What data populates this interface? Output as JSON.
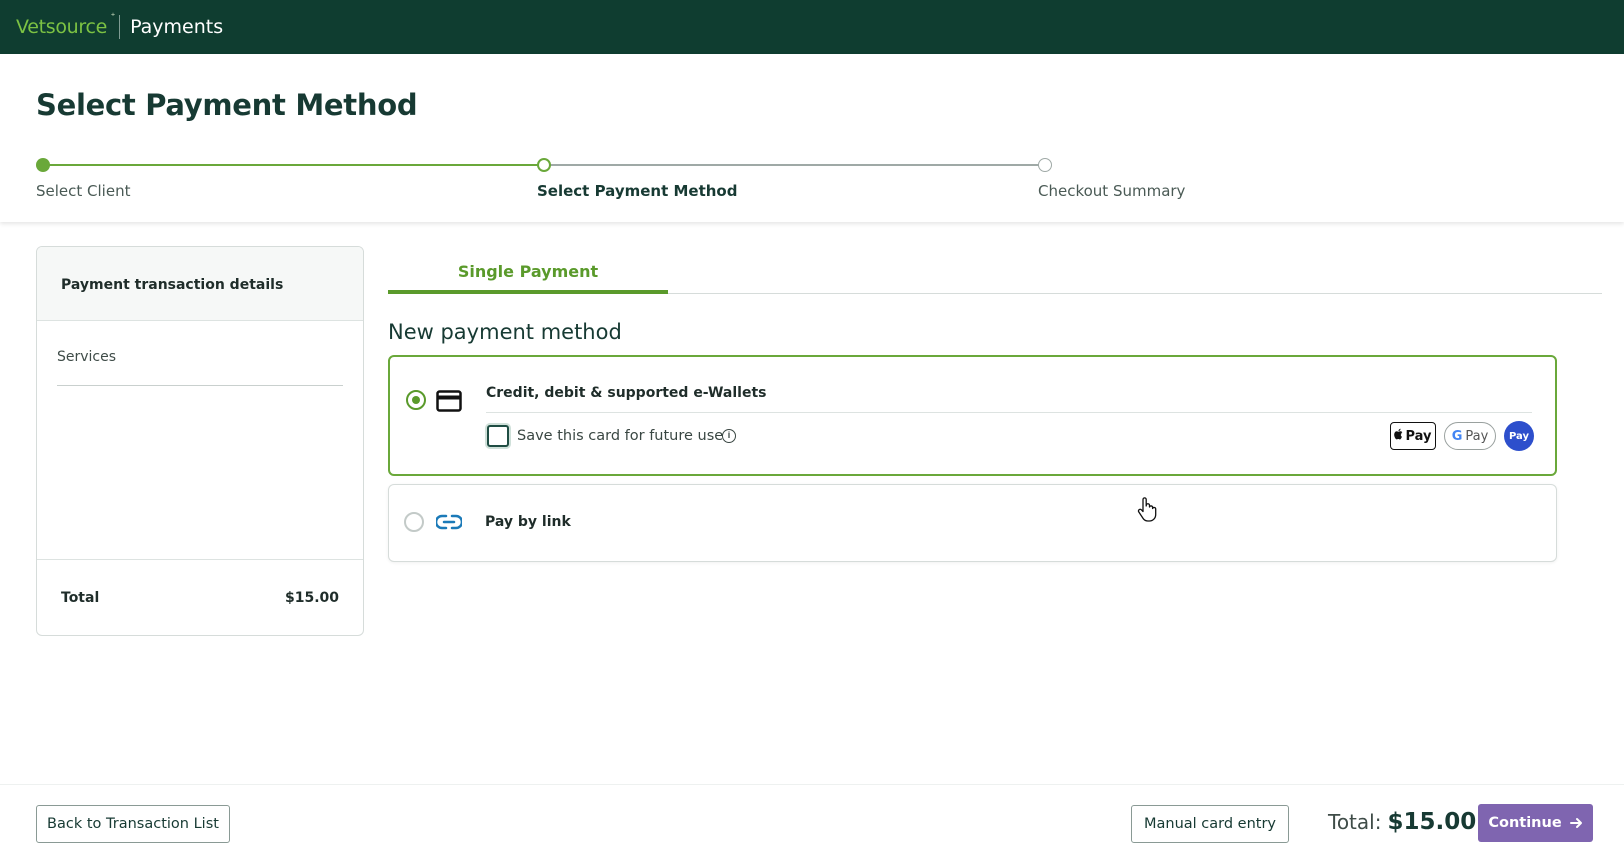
{
  "topbar": {
    "brand": "Vetsource",
    "app_name": "Payments"
  },
  "page": {
    "title": "Select Payment Method"
  },
  "stepper": {
    "steps": [
      {
        "label": "Select Client"
      },
      {
        "label": "Select Payment Method"
      },
      {
        "label": "Checkout Summary"
      }
    ]
  },
  "summary": {
    "header": "Payment transaction details",
    "services_label": "Services",
    "total_label": "Total",
    "total_value": "$15.00"
  },
  "tabs": [
    {
      "label": "Single Payment"
    }
  ],
  "payment": {
    "section_title": "New payment method",
    "card_option": {
      "label": "Credit, debit & supported e-Wallets",
      "save_label": "Save this card for future use",
      "wallets": {
        "apple": "Pay",
        "google": "Pay",
        "generic": "Pay"
      }
    },
    "link_option": {
      "label": "Pay by link"
    }
  },
  "footer": {
    "back_label": "Back to Transaction List",
    "manual_label": "Manual card entry",
    "total_label": "Total:",
    "total_value": "$15.00",
    "continue_label": "Continue"
  },
  "colors": {
    "topbar": "#0f3d30",
    "brand_green": "#7cc243",
    "accent_green": "#5a9a2b",
    "primary_button": "#7f65b0"
  },
  "icons": [
    "info-icon",
    "card-icon",
    "link-icon",
    "arrow-right-icon",
    "hand-cursor-icon"
  ]
}
